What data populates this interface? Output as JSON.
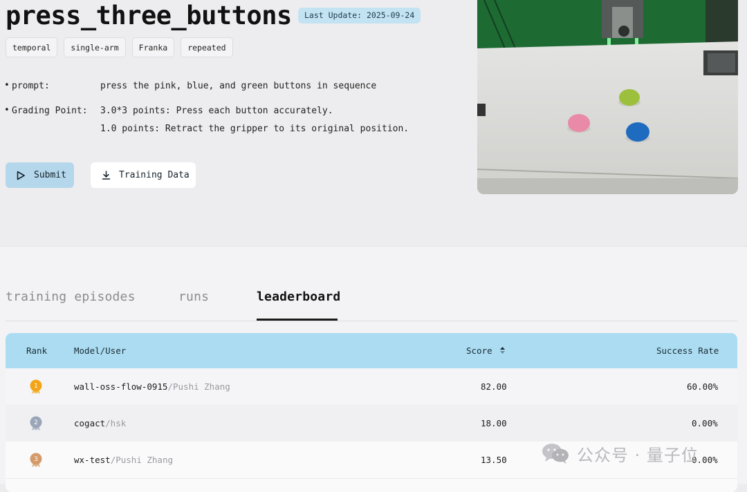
{
  "task": {
    "title": "press_three_buttons",
    "last_update": "Last Update: 2025-09-24",
    "tags": [
      "temporal",
      "single-arm",
      "Franka",
      "repeated"
    ],
    "prompt_label": "prompt:",
    "prompt_value": "press the pink, blue, and green buttons in sequence",
    "grading_label": "Grading Point:",
    "grading_lines": [
      "3.0*3 points: Press each button accurately.",
      "1.0 points: Retract the gripper to its original position."
    ],
    "bullet": "•"
  },
  "actions": {
    "submit": "Submit",
    "training_data": "Training Data"
  },
  "tabs": [
    {
      "label": "training episodes",
      "active": false
    },
    {
      "label": "runs",
      "active": false
    },
    {
      "label": "leaderboard",
      "active": true
    }
  ],
  "leaderboard": {
    "columns": {
      "rank": "Rank",
      "model": "Model/User",
      "score": "Score",
      "success": "Success Rate"
    },
    "rows": [
      {
        "rank": "1",
        "model": "wall-oss-flow-0915",
        "user": "/Pushi Zhang",
        "score": "82.00",
        "success": "60.00%",
        "medal_color": "#f2a516"
      },
      {
        "rank": "2",
        "model": "cogact",
        "user": "/hsk",
        "score": "18.00",
        "success": "0.00%",
        "medal_color": "#9aa6b8"
      },
      {
        "rank": "3",
        "model": "wx-test",
        "user": "/Pushi Zhang",
        "score": "13.50",
        "success": "0.00%",
        "medal_color": "#d49a6a"
      }
    ]
  },
  "watermark": {
    "text": "公众号 · 量子位",
    "icon": "wechat-icon"
  },
  "colors": {
    "accent_blue": "#abdcf1",
    "submit_blue": "#b5d7eb",
    "badge_blue": "#c3e2f2"
  }
}
